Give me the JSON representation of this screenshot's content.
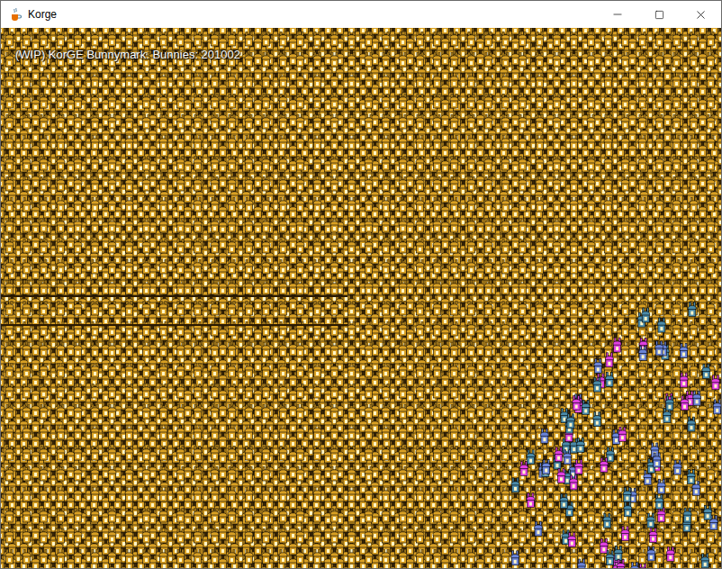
{
  "window": {
    "title": "Korge"
  },
  "canvas": {
    "hud": "(WIP) KorGE Bunnymark. Bunnies: 201002"
  },
  "sprites": [
    {
      "kind": "bunny",
      "name": "field",
      "color": "#d9a023"
    },
    {
      "kind": "bunny",
      "name": "pink",
      "color": "#e040e0"
    },
    {
      "kind": "bunny",
      "name": "blue",
      "color": "#6a84d8"
    },
    {
      "kind": "bunny",
      "name": "teal",
      "color": "#4a8aa8"
    }
  ]
}
